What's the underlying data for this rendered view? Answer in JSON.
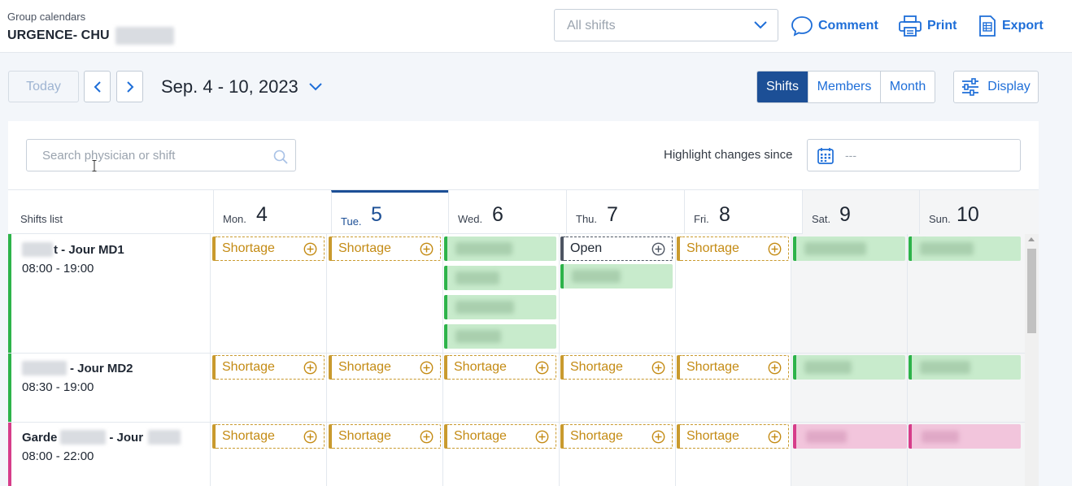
{
  "header": {
    "breadcrumb": "Group calendars",
    "group_title": "URGENCE- CHU",
    "shift_filter": "All shifts",
    "comment_label": "Comment",
    "print_label": "Print",
    "export_label": "Export"
  },
  "toolbar": {
    "today_label": "Today",
    "date_range": "Sep. 4 - 10, 2023",
    "views": [
      "Shifts",
      "Members",
      "Month"
    ],
    "active_view": "Shifts",
    "display_label": "Display"
  },
  "panel": {
    "search_placeholder": "Search physician or shift",
    "highlight_label": "Highlight changes since",
    "highlight_value": "---"
  },
  "grid": {
    "shifts_list_label": "Shifts list",
    "days": [
      {
        "name": "Mon.",
        "num": "4"
      },
      {
        "name": "Tue.",
        "num": "5"
      },
      {
        "name": "Wed.",
        "num": "6"
      },
      {
        "name": "Thu.",
        "num": "7"
      },
      {
        "name": "Fri.",
        "num": "8"
      },
      {
        "name": "Sat.",
        "num": "9"
      },
      {
        "name": "Sun.",
        "num": "10"
      }
    ],
    "shortage_label": "Shortage",
    "open_label": "Open",
    "rows": [
      {
        "name_visible": "t - Jour MD1",
        "time": "08:00 - 19:00",
        "color": "#2db34a"
      },
      {
        "name_visible": "- Jour MD2",
        "time": "08:30 - 19:00",
        "color": "#2db34a"
      },
      {
        "name_prefix": "Garde",
        "name_mid": "- Jour",
        "time": "08:00 - 22:00",
        "color": "#d63d8a"
      }
    ]
  },
  "colors": {
    "accent": "#1e6ed8",
    "active_view": "#1c4f96",
    "shortage": "#c99a2e",
    "assigned": "#2db34a",
    "assigned_pink": "#d63d8a"
  }
}
